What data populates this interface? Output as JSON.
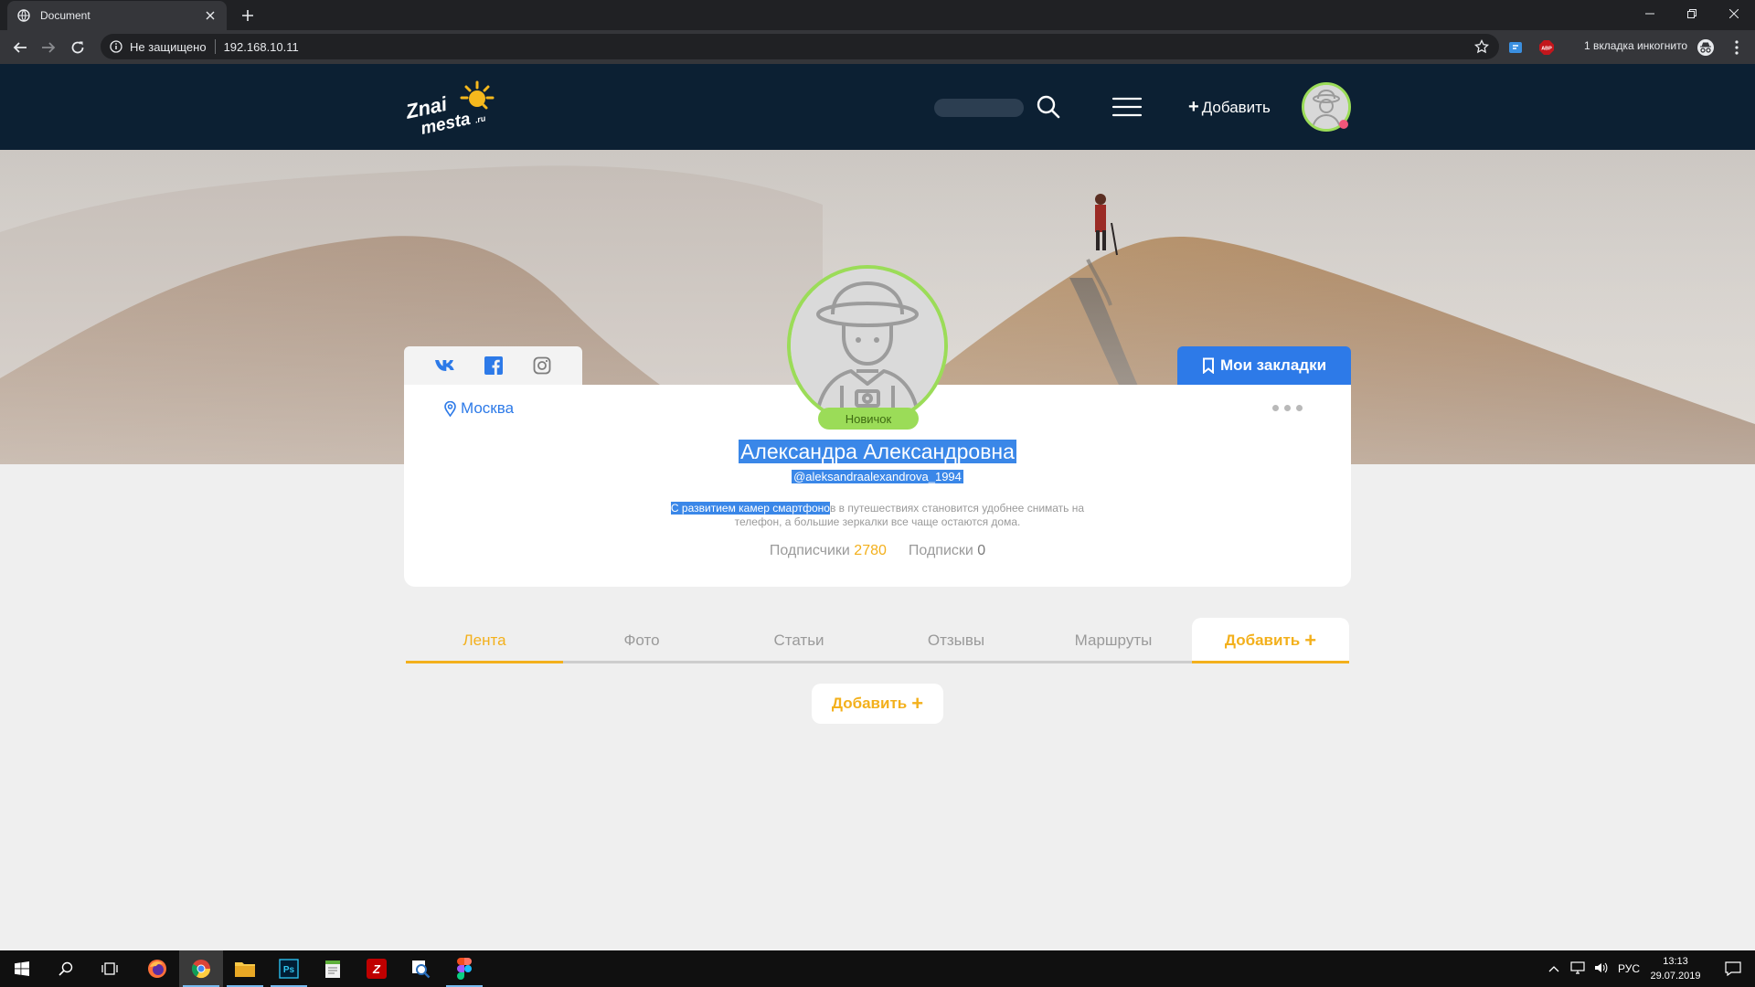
{
  "browser": {
    "tab_title": "Document",
    "security_label": "Не защищено",
    "url": "192.168.10.11",
    "incognito_label": "1 вкладка инкогнито",
    "abp_label": "ABP"
  },
  "header": {
    "logo_text_1": "Znai",
    "logo_text_2": "mesta",
    "logo_text_3": ".ru",
    "add_label": "Добавить"
  },
  "profile": {
    "social_links": [
      "vk",
      "facebook",
      "instagram"
    ],
    "bookmarks_label": "Мои закладки",
    "city": "Москва",
    "rank": "Новичок",
    "full_name": "Александра Александровна",
    "handle": "@aleksandraalexandrova_1994",
    "bio_highlight": "С развитием камер смартфоно",
    "bio_rest_1": "в в путешествиях становится удобнее снимать на",
    "bio_rest_2": "телефон, а большие зеркалки все чаще остаются дома.",
    "followers_label": "Подписчики",
    "followers_count": "2780",
    "following_label": "Подписки",
    "following_count": "0"
  },
  "tabs": [
    {
      "label": "Лента",
      "active": true
    },
    {
      "label": "Фото"
    },
    {
      "label": "Статьи"
    },
    {
      "label": "Отзывы"
    },
    {
      "label": "Маршруты"
    },
    {
      "label": "Добавить"
    }
  ],
  "content": {
    "add_label": "Добавить"
  },
  "taskbar": {
    "lang": "РУС",
    "time": "13:13",
    "date": "29.07.2019"
  },
  "colors": {
    "header_bg": "#0c2033",
    "accent_yellow": "#f3b01c",
    "accent_blue": "#2d7ae8",
    "accent_green": "#9bdc58",
    "page_bg": "#efefef"
  },
  "icons": [
    "globe-icon",
    "close-icon",
    "plus-icon",
    "minimize-icon",
    "restore-icon",
    "back-icon",
    "forward-icon",
    "reload-icon",
    "info-icon",
    "star-icon",
    "incognito-icon",
    "menu-dots-icon",
    "search-icon",
    "burger-icon",
    "map-pin-icon",
    "bookmark-icon",
    "vk-icon",
    "facebook-icon",
    "instagram-icon",
    "windows-icon"
  ]
}
